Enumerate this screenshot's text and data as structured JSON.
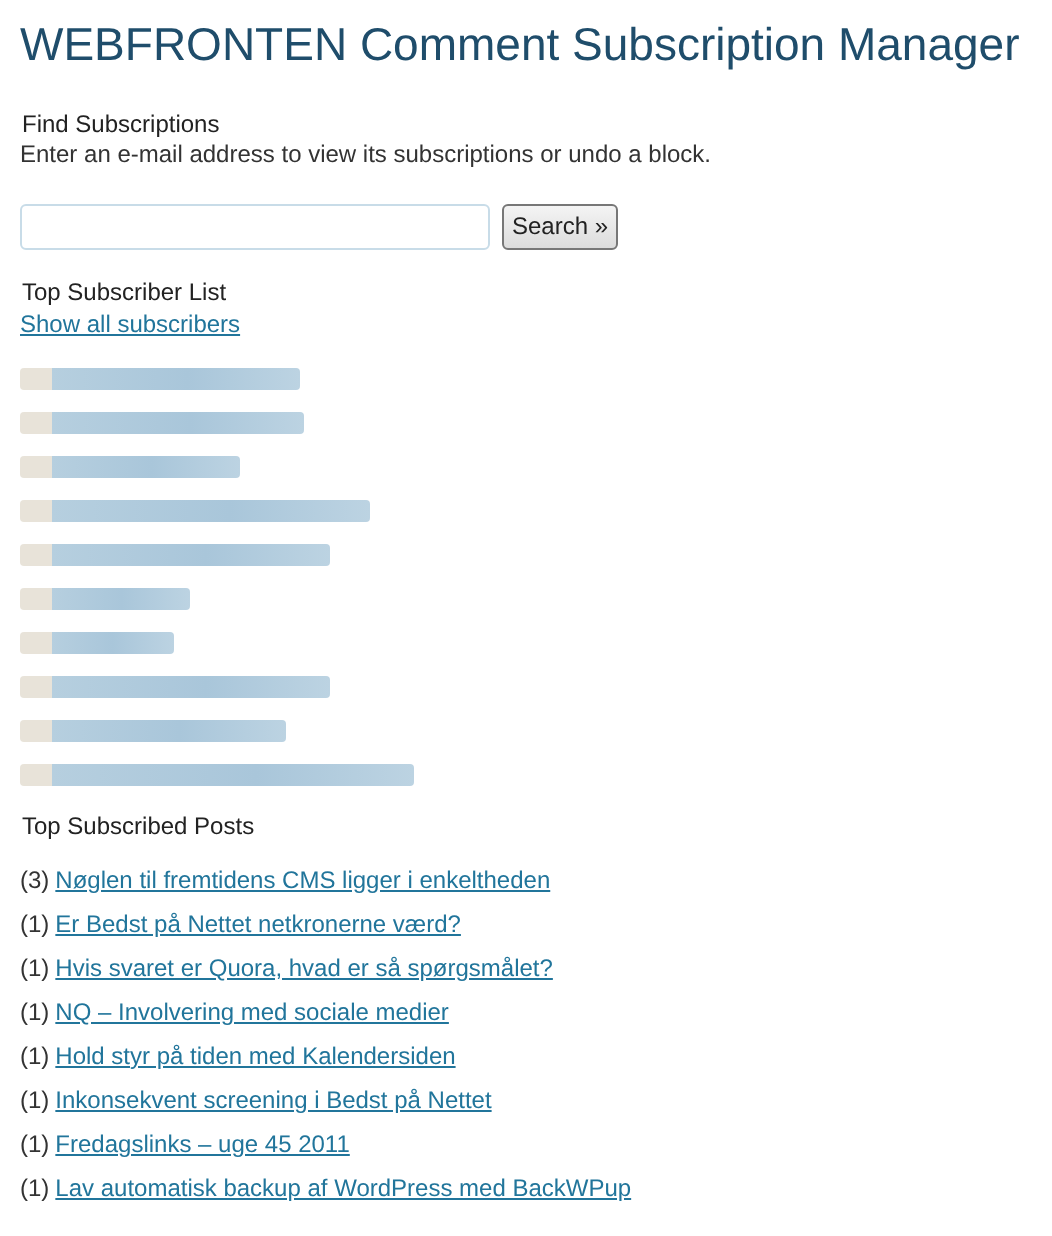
{
  "title": "WEBFRONTEN Comment Subscription Manager",
  "find": {
    "heading": "Find Subscriptions",
    "description": "Enter an e-mail address to view its subscriptions or undo a block.",
    "search_button": "Search »"
  },
  "subscribers": {
    "heading": "Top Subscriber List",
    "show_all": "Show all subscribers",
    "items": [
      {
        "kind": "blurred"
      },
      {
        "kind": "blurred"
      },
      {
        "kind": "blurred"
      },
      {
        "kind": "blurred"
      },
      {
        "kind": "blurred"
      },
      {
        "kind": "blurred"
      },
      {
        "kind": "blurred"
      },
      {
        "kind": "blurred"
      },
      {
        "kind": "blurred"
      },
      {
        "kind": "blurred"
      }
    ]
  },
  "posts": {
    "heading": "Top Subscribed Posts",
    "items": [
      {
        "count": "(3)",
        "title": "Nøglen til fremtidens CMS ligger i enkeltheden"
      },
      {
        "count": "(1)",
        "title": "Er Bedst på Nettet netkronerne værd?"
      },
      {
        "count": "(1)",
        "title": "Hvis svaret er Quora, hvad er så spørgsmålet?"
      },
      {
        "count": "(1)",
        "title": "NQ – Involvering med sociale medier"
      },
      {
        "count": "(1)",
        "title": "Hold styr på tiden med Kalendersiden"
      },
      {
        "count": "(1)",
        "title": "Inkonsekvent screening i Bedst på Nettet"
      },
      {
        "count": "(1)",
        "title": "Fredagslinks – uge 45 2011"
      },
      {
        "count": "(1)",
        "title": "Lav automatisk backup af WordPress med BackWPup"
      }
    ]
  }
}
